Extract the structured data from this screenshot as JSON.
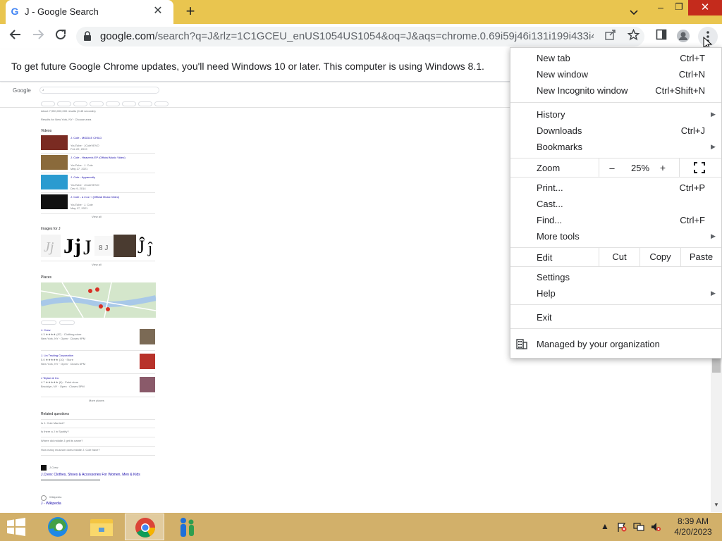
{
  "tab": {
    "favicon": "G",
    "title": "J - Google Search",
    "close": "✕",
    "new_tab": "+"
  },
  "window_controls": {
    "minimize": "–",
    "maximize": "❐",
    "close": "✕"
  },
  "omnibox": {
    "host": "google.com",
    "rest": "/search?q=J&rlz=1C1GCEU_enUS1054US1054&oq=J&aqs=chrome.0.69i59j46i131i199i433i465i512j..."
  },
  "infobar": {
    "text": "To get future Google Chrome updates, you'll need Windows 10 or later. This computer is using Windows 8.1."
  },
  "results": {
    "logo": "Google",
    "query": "J",
    "stats": "About 7,950,000,000 results (0.45 seconds)",
    "location": "Results for New York, NY · Choose area",
    "videos_header": "Videos",
    "videos": [
      {
        "title": "J. Cole - MIDDLE CHILD",
        "source": "YouTube · JColeVEVO",
        "date": "Feb 22, 2019"
      },
      {
        "title": "J. Cole - Heaven's EP (Official Music Video)",
        "source": "YouTube · J. Cole",
        "date": "May 27, 2021"
      },
      {
        "title": "J. Cole - Apparently",
        "source": "YouTube · JColeVEVO",
        "date": "Dec 9, 2014"
      },
      {
        "title": "J. Cole - a m a r i (Official Music Video)",
        "source": "YouTube · J. Cole",
        "date": "May 17, 2021"
      }
    ],
    "view_all": "View all",
    "images_header": "Images for J",
    "places_header": "Places",
    "places": [
      {
        "name": "J. Crew",
        "meta": "4.3 ★★★★ (87) · Clothing store",
        "addr": "New York, NY · Open · Closes 9PM"
      },
      {
        "name": "J. Lin Trading Corporation",
        "meta": "5.0 ★★★★★ (10) · Store",
        "addr": "New York, NY · Open · Closes 6PM"
      },
      {
        "name": "J Teplan & Co.",
        "meta": "4.7 ★★★★★ (6) · Paint store",
        "addr": "Brooklyn, NY · Open · Closes 5PM"
      }
    ],
    "more_places": "More places",
    "related_header": "Related questions",
    "questions": [
      "Is J. Cole Married?",
      "Is there a J in Spotify?",
      "Where did middle J get its name?",
      "How many museum does middle J. Cole have?"
    ],
    "result1_site": "J.Crew",
    "result1_title": "J.Crew: Clothes, Shoes & Accessories For Women, Men & Kids",
    "result2_site": "Wikipedia",
    "result2_title": "J - Wikipedia"
  },
  "menu": {
    "new_tab": "New tab",
    "new_tab_sc": "Ctrl+T",
    "new_window": "New window",
    "new_window_sc": "Ctrl+N",
    "incognito": "New Incognito window",
    "incognito_sc": "Ctrl+Shift+N",
    "history": "History",
    "downloads": "Downloads",
    "downloads_sc": "Ctrl+J",
    "bookmarks": "Bookmarks",
    "zoom": "Zoom",
    "zoom_minus": "–",
    "zoom_value": "25%",
    "zoom_plus": "+",
    "print": "Print...",
    "print_sc": "Ctrl+P",
    "cast": "Cast...",
    "find": "Find...",
    "find_sc": "Ctrl+F",
    "more_tools": "More tools",
    "edit": "Edit",
    "cut": "Cut",
    "copy": "Copy",
    "paste": "Paste",
    "settings": "Settings",
    "help": "Help",
    "exit": "Exit",
    "managed": "Managed by your organization"
  },
  "taskbar": {
    "time": "8:39 AM",
    "date": "4/20/2023"
  },
  "colors": {
    "accent_frame": "#e9c54f",
    "taskbar": "#d2b06a",
    "close_red": "#c42b1c"
  }
}
